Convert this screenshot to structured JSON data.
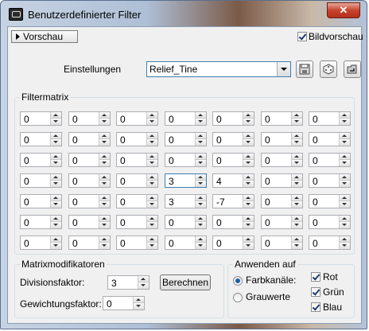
{
  "window": {
    "title": "Benutzerdefinierter Filter",
    "close_label": "✕"
  },
  "preview": {
    "toggle_label": "Vorschau",
    "image_preview_label": "Bildvorschau",
    "image_preview_checked": true
  },
  "settings": {
    "label": "Einstellungen",
    "preset_value": "Relief_Tine",
    "icons": [
      "save-icon",
      "random-dice-icon",
      "load-folder-icon"
    ]
  },
  "filter_matrix": {
    "title": "Filtermatrix",
    "rows": [
      [
        "0",
        "0",
        "0",
        "0",
        "0",
        "0",
        "0"
      ],
      [
        "0",
        "0",
        "0",
        "0",
        "0",
        "0",
        "0"
      ],
      [
        "0",
        "0",
        "0",
        "0",
        "0",
        "0",
        "0"
      ],
      [
        "0",
        "0",
        "0",
        "3",
        "4",
        "0",
        "0"
      ],
      [
        "0",
        "0",
        "0",
        "3",
        "-7",
        "0",
        "0"
      ],
      [
        "0",
        "0",
        "0",
        "0",
        "0",
        "0",
        "0"
      ],
      [
        "0",
        "0",
        "0",
        "0",
        "0",
        "0",
        "0"
      ]
    ]
  },
  "modifiers": {
    "title": "Matrixmodifikatoren",
    "division_label": "Divisionsfaktor:",
    "division_value": "3",
    "calculate_label": "Berechnen",
    "weight_label": "Gewichtungsfaktor:",
    "weight_value": "0"
  },
  "apply_to": {
    "title": "Anwenden auf",
    "color_channels_label": "Farbkanäle:",
    "grayscale_label": "Grauwerte",
    "selected": "color_channels",
    "red_label": "Rot",
    "green_label": "Grün",
    "blue_label": "Blau",
    "red_checked": true,
    "green_checked": true,
    "blue_checked": true
  },
  "colors": {
    "close_button": "#c7432d",
    "focus_border": "#3c7fb1",
    "panel": "#f0f0f0"
  }
}
